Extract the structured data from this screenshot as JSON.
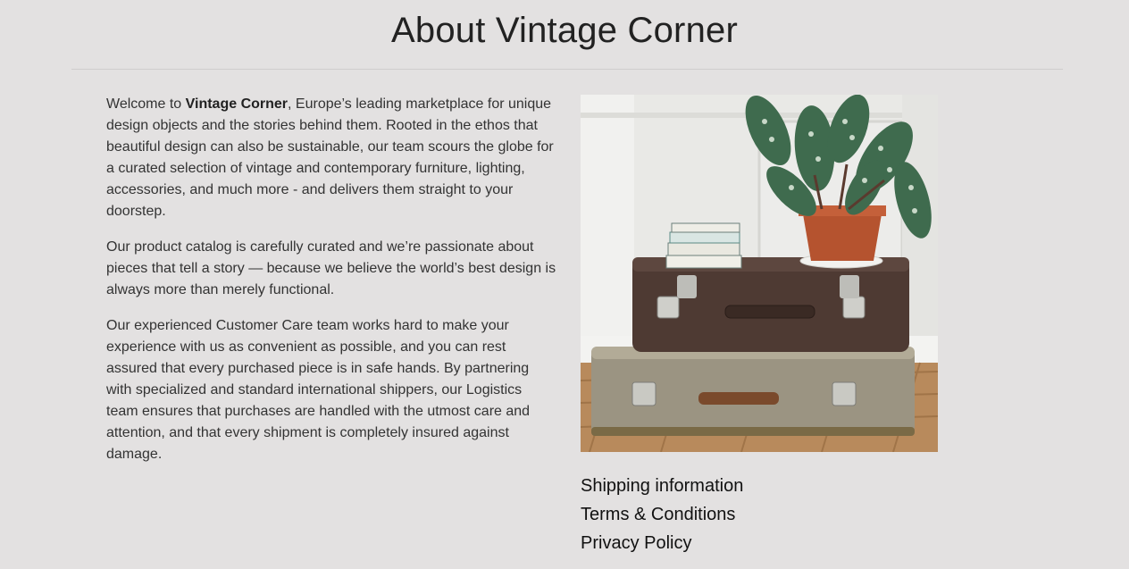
{
  "page": {
    "title": "About Vintage Corner"
  },
  "about": {
    "p1_prefix": "Welcome to ",
    "p1_brand": "Vintage Corner",
    "p1_suffix": ", Europe’s leading marketplace for unique design objects and the stories behind them. Rooted in the ethos that beautiful design can also be sustainable, our team scours the globe for a curated selection of vintage and contemporary furniture, lighting, accessories, and much more - and delivers them straight to your doorstep.",
    "p2": "Our product catalog is carefully curated and we’re passionate about pieces that tell a story — because we believe the world’s best design is always more than merely functional.",
    "p3": "Our experienced Customer Care team works hard to make your experience with us as convenient as possible, and you can rest assured that every purchased piece is in safe hands. By partnering with specialized and standard international shippers, our Logistics team ensures that purchases are handled with the utmost care and attention, and that every shipment is completely insured against damage."
  },
  "links": [
    {
      "label": "Shipping information"
    },
    {
      "label": "Terms & Conditions"
    },
    {
      "label": "Privacy Policy"
    }
  ],
  "colors": {
    "background": "#e3e1e1",
    "text": "#333333",
    "title": "#222222"
  }
}
